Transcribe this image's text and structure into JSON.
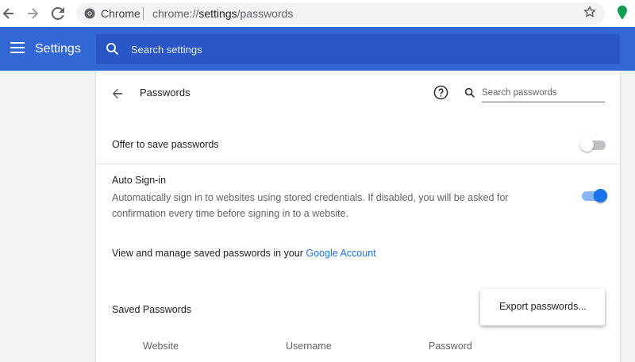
{
  "browser": {
    "chip_label": "Chrome",
    "url_scheme": "chrome://",
    "url_host": "settings",
    "url_path": "/passwords",
    "icons": [
      "back-arrow-icon",
      "forward-arrow-icon",
      "reload-icon",
      "chrome-icon",
      "star-icon",
      "extension-icon"
    ]
  },
  "header": {
    "title": "Settings",
    "search_placeholder": "Search settings"
  },
  "page": {
    "title": "Passwords",
    "search_placeholder": "Search passwords"
  },
  "settings": {
    "offer_to_save": {
      "label": "Offer to save passwords",
      "enabled": false
    },
    "auto_signin": {
      "label": "Auto Sign-in",
      "description": "Automatically sign in to websites using stored credentials. If disabled, you will be asked for confirmation every time before signing in to a website.",
      "enabled": true
    },
    "manage": {
      "text": "View and manage saved passwords in your ",
      "link": "Google Account"
    }
  },
  "saved_passwords": {
    "title": "Saved Passwords",
    "columns": [
      "Website",
      "Username",
      "Password"
    ]
  },
  "menu": {
    "export_label": "Export passwords..."
  },
  "colors": {
    "header_blue": "#3367d6",
    "search_blue": "#2a56c6",
    "link_blue": "#1a73e8",
    "toggle_on": "#1a73e8",
    "toggle_off": "#bdc1c6"
  }
}
